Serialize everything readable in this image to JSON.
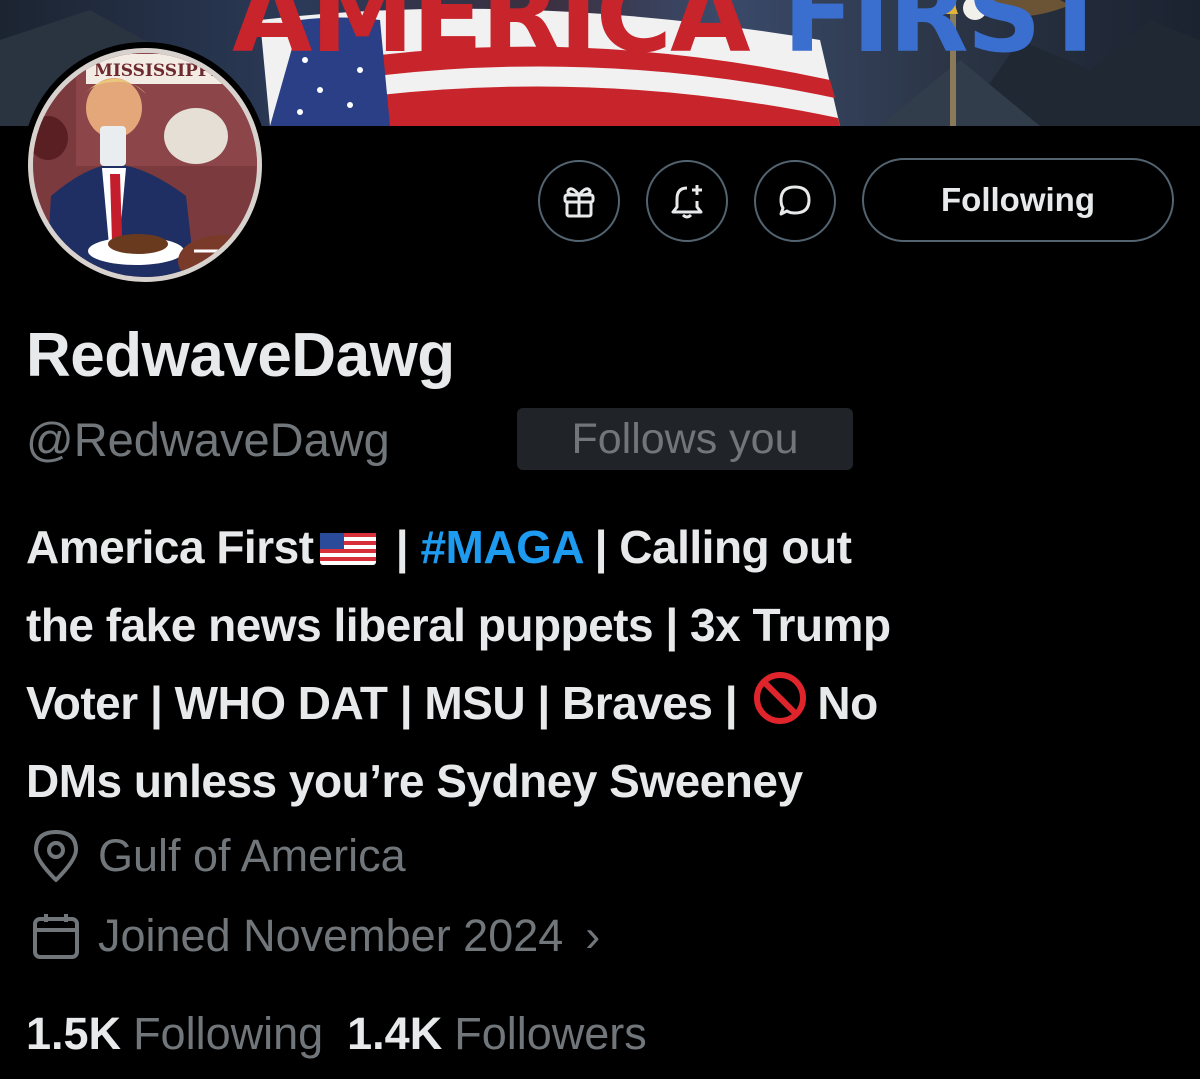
{
  "banner": {
    "headline_word1": "AMERICA",
    "headline_word2": "FIRST"
  },
  "avatar": {
    "label": "MISSISSIPPI STATE"
  },
  "actions": {
    "gift_icon": "gift-icon",
    "notify_icon": "bell-plus-icon",
    "message_icon": "message-icon",
    "follow_label": "Following"
  },
  "profile": {
    "display_name": "RedwaveDawg",
    "handle": "@RedwaveDawg",
    "follows_you": "Follows you",
    "bio": {
      "l1_a": "America First",
      "l1_sep1": " | ",
      "l1_hashtag": "#MAGA",
      "l1_b": " | Calling out",
      "l2": "the fake news liberal puppets | 3x Trump",
      "l3_a": "Voter | WHO DAT | MSU | Braves | ",
      "l3_b": "No",
      "l4": "DMs unless you’re Sydney Sweeney"
    },
    "location": "Gulf of America",
    "joined": "Joined November 2024",
    "joined_chevron": "›"
  },
  "stats": {
    "following_count": "1.5K",
    "following_label": "Following",
    "followers_count": "1.4K",
    "followers_label": "Followers"
  },
  "colors": {
    "background": "#000000",
    "text": "#e7e9ea",
    "muted": "#71767b",
    "accent": "#1d9bf0",
    "border": "#536471"
  }
}
